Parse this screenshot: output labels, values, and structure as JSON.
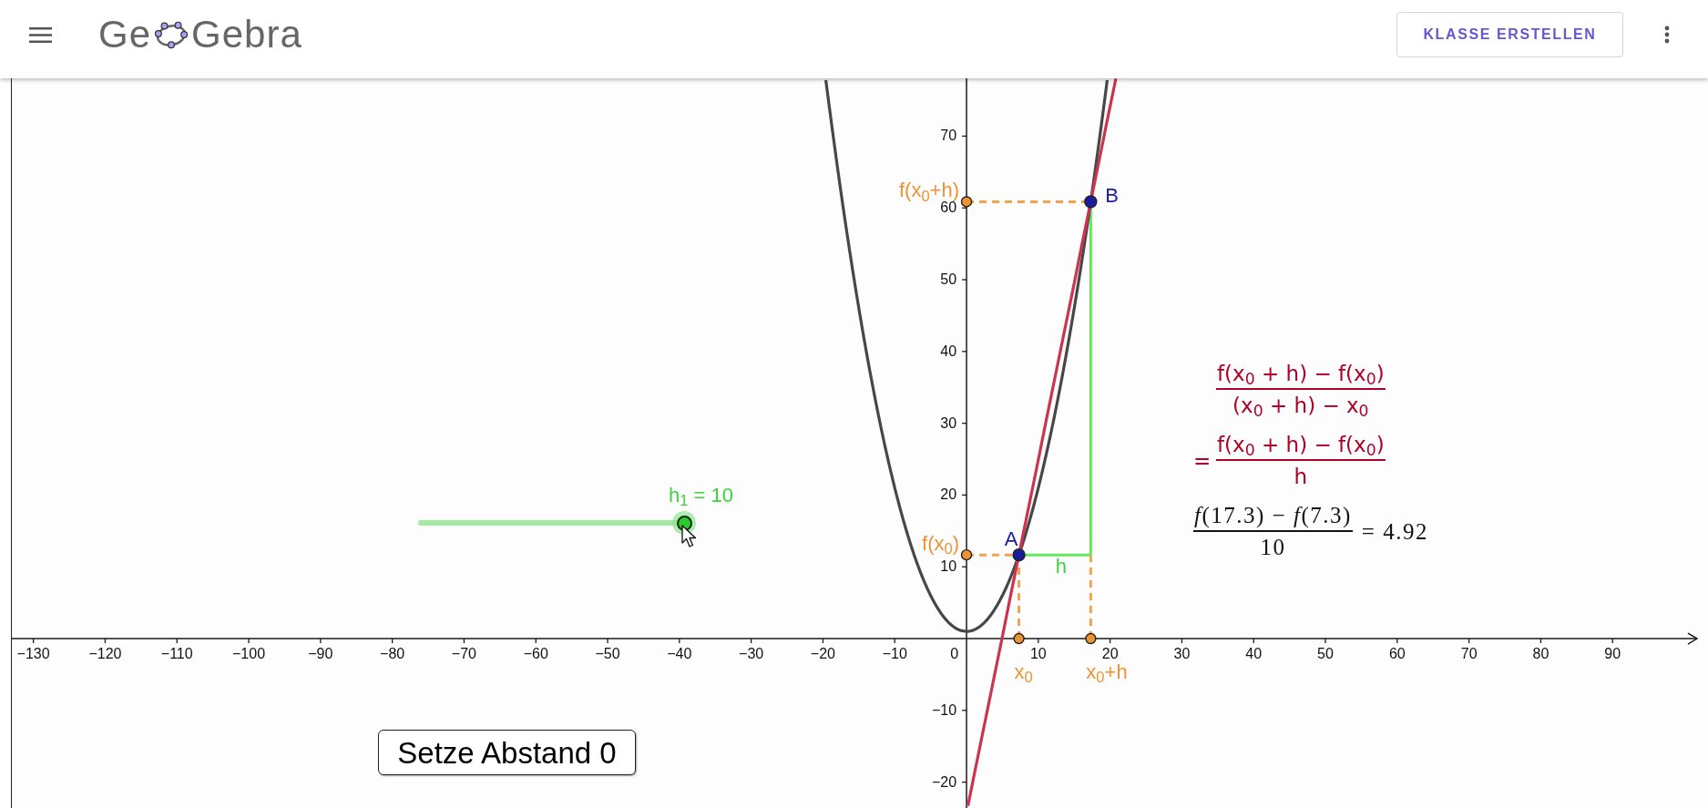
{
  "header": {
    "logo": {
      "before_icon": "Ge",
      "after_icon": "Gebra"
    },
    "button": "KLASSE ERSTELLEN"
  },
  "graph": {
    "chart_data": {
      "type": "line",
      "x": [
        -19.6,
        -19,
        -18,
        -17,
        -16,
        -15,
        -14,
        -13,
        -12,
        -11,
        -10,
        -9,
        -8,
        -7,
        -6,
        -5,
        -4,
        -3,
        -2,
        -1,
        0,
        0.2,
        1,
        2,
        3,
        4,
        5,
        6,
        7,
        8,
        9,
        10,
        11,
        12,
        13,
        14,
        15,
        16,
        17,
        18,
        19,
        19.6,
        20.8
      ],
      "series": [
        {
          "color": "#474747",
          "values": [
            77.8,
            73.2,
            65.8,
            58.8,
            52.2,
            46,
            40.2,
            34.8,
            29.8,
            25.2,
            21,
            17.2,
            13.8,
            10.8,
            8.2,
            6,
            4.2,
            2.8,
            1.8,
            1.2,
            1,
            1,
            1.2,
            1.8,
            2.8,
            4.2,
            6,
            8.2,
            10.8,
            13.8,
            17.2,
            21,
            25.2,
            29.8,
            34.8,
            40.2,
            46,
            52.2,
            58.8,
            65.8,
            73.2,
            77.8,
            null
          ]
        },
        {
          "color": "#cc3350",
          "values": [
            null,
            null,
            null,
            null,
            null,
            null,
            null,
            null,
            null,
            null,
            null,
            null,
            null,
            null,
            null,
            null,
            null,
            null,
            null,
            null,
            null,
            -23.3,
            -19.3,
            -14.4,
            -9.5,
            -4.6,
            0.3,
            5.3,
            10.2,
            15.1,
            20,
            24.9,
            29.9,
            34.8,
            39.7,
            44.6,
            49.5,
            54.5,
            59.4,
            64.3,
            69.2,
            72.2,
            78
          ]
        }
      ],
      "xlim": [
        -133,
        101.9
      ],
      "ylim": [
        -23.6,
        78.05
      ],
      "xticks": [
        {
          "value": -130,
          "label": "−130"
        },
        {
          "value": -120,
          "label": "−120"
        },
        {
          "value": -110,
          "label": "−110"
        },
        {
          "value": -100,
          "label": "−100"
        },
        {
          "value": -90,
          "label": "−90"
        },
        {
          "value": -80,
          "label": "−80"
        },
        {
          "value": -70,
          "label": "−70"
        },
        {
          "value": -60,
          "label": "−60"
        },
        {
          "value": -50,
          "label": "−50"
        },
        {
          "value": -40,
          "label": "−40"
        },
        {
          "value": -30,
          "label": "−30"
        },
        {
          "value": -20,
          "label": "−20"
        },
        {
          "value": -10,
          "label": "−10"
        },
        {
          "value": 10,
          "label": "10"
        },
        {
          "value": 20,
          "label": "20"
        },
        {
          "value": 30,
          "label": "30"
        },
        {
          "value": 40,
          "label": "40"
        },
        {
          "value": 50,
          "label": "50"
        },
        {
          "value": 60,
          "label": "60"
        },
        {
          "value": 70,
          "label": "70"
        },
        {
          "value": 80,
          "label": "80"
        },
        {
          "value": 90,
          "label": "90"
        }
      ],
      "yticks": [
        {
          "value": 70,
          "label": "70"
        },
        {
          "value": 60,
          "label": "60"
        },
        {
          "value": 50,
          "label": "50"
        },
        {
          "value": 40,
          "label": "40"
        },
        {
          "value": 30,
          "label": "30"
        },
        {
          "value": 20,
          "label": "20"
        },
        {
          "value": 10,
          "label": "10"
        },
        {
          "value": -10,
          "label": "−10"
        },
        {
          "value": -20,
          "label": "−20"
        }
      ],
      "annotations": [
        {
          "text": "f(x$_{0}$+h)",
          "x": 0,
          "y": 60.86
        },
        {
          "text": "f(x$_{0}$)",
          "x": 0,
          "y": 11.66
        },
        {
          "text": "x$_{0}$",
          "x": 7.3,
          "y": 0
        },
        {
          "text": "x$_{0}$+h",
          "x": 17.3,
          "y": 0
        },
        {
          "text": "A",
          "x": 7.3,
          "y": 11.66
        },
        {
          "text": "B",
          "x": 17.3,
          "y": 60.86
        }
      ]
    },
    "origin_label": "0",
    "triangle_label": "h",
    "slider": {
      "label": "h$_{1}$ = 10",
      "level": 1
    },
    "formula": [
      {
        "kind": "symbolic",
        "numerator": "f(x$_{0}$ + h) − f(x$_{0}$)",
        "denominator": "(x$_{0}$ + h) − x$_{0}$"
      },
      {
        "kind": "symbolic",
        "prefix": "=",
        "numerator": "f(x$_{0}$ + h) − f(x$_{0}$)",
        "denominator": "h"
      },
      {
        "kind": "numeric",
        "numerator": "*f*(17.3) − *f*(7.3)",
        "denominator": "10",
        "suffix": "= 4.92"
      }
    ],
    "button": {
      "label": "Setze Abstand 0"
    }
  }
}
